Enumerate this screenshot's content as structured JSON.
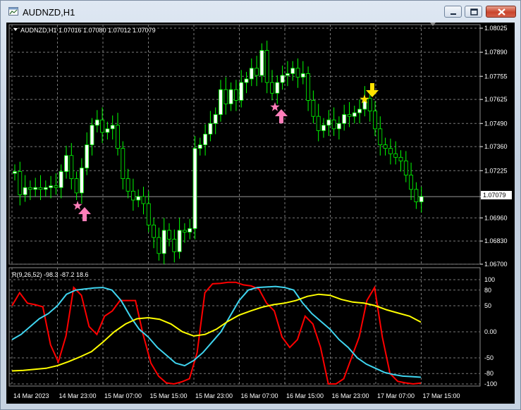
{
  "window": {
    "title": "AUDNZD,H1"
  },
  "chart": {
    "symbol_info": "AUDNZD,H1  1.07016 1.07080 1.07012 1.07079",
    "current_price": "1.07079",
    "price_ticks": [
      "1.08025",
      "1.07890",
      "1.07755",
      "1.07625",
      "1.07490",
      "1.07360",
      "1.07225",
      "1.07079",
      "1.06960",
      "1.06830",
      "1.06700"
    ],
    "indicator_label": "R(9,26,52) -98.3 -87.2 18.6",
    "indicator_ticks": [
      "100",
      "80",
      "50",
      "0.00",
      "-50",
      "-80",
      "-100"
    ],
    "time_ticks": [
      "14 Mar 2023",
      "14 Mar 23:00",
      "15 Mar 07:00",
      "15 Mar 15:00",
      "15 Mar 23:00",
      "16 Mar 07:00",
      "16 Mar 15:00",
      "16 Mar 23:00",
      "17 Mar 07:00",
      "17 Mar 15:00"
    ],
    "colors": {
      "background": "#000000",
      "bull": "#ffffff",
      "bear": "#000000",
      "wick": "#00ff00",
      "fast": "#ff0000",
      "mid": "#3fd5f0",
      "slow": "#ffff00",
      "buy_signal": "#ff7eb9",
      "sell_signal": "#ffe100"
    }
  },
  "chart_data": [
    {
      "type": "candlestick",
      "title": "AUDNZD,H1",
      "ylim": [
        1.067,
        1.08025
      ],
      "series_note": "approximate open/close per hourly bar",
      "candles": [
        [
          1.0721,
          1.0722
        ],
        [
          1.0722,
          1.0709
        ],
        [
          1.0709,
          1.0713
        ],
        [
          1.0713,
          1.0712
        ],
        [
          1.0712,
          1.0713
        ],
        [
          1.0713,
          1.0712
        ],
        [
          1.0712,
          1.0713
        ],
        [
          1.0713,
          1.0714
        ],
        [
          1.0714,
          1.0713
        ],
        [
          1.0713,
          1.0722
        ],
        [
          1.0722,
          1.0731
        ],
        [
          1.0731,
          1.0718
        ],
        [
          1.0718,
          1.071
        ],
        [
          1.071,
          1.0724
        ],
        [
          1.0724,
          1.0737
        ],
        [
          1.0737,
          1.0748
        ],
        [
          1.0748,
          1.0751
        ],
        [
          1.0751,
          1.0744
        ],
        [
          1.0744,
          1.0746
        ],
        [
          1.0746,
          1.0748
        ],
        [
          1.0748,
          1.0735
        ],
        [
          1.0735,
          1.0718
        ],
        [
          1.0718,
          1.0711
        ],
        [
          1.0711,
          1.0706
        ],
        [
          1.0706,
          1.0708
        ],
        [
          1.0708,
          1.0704
        ],
        [
          1.0704,
          1.0692
        ],
        [
          1.0692,
          1.0685
        ],
        [
          1.0685,
          1.0676
        ],
        [
          1.0676,
          1.0689
        ],
        [
          1.0689,
          1.0684
        ],
        [
          1.0684,
          1.0677
        ],
        [
          1.0677,
          1.0689
        ],
        [
          1.0689,
          1.0688
        ],
        [
          1.0688,
          1.069
        ],
        [
          1.069,
          1.0735
        ],
        [
          1.0735,
          1.0737
        ],
        [
          1.0737,
          1.0743
        ],
        [
          1.0743,
          1.0749
        ],
        [
          1.0749,
          1.0754
        ],
        [
          1.0754,
          1.0768
        ],
        [
          1.0768,
          1.076
        ],
        [
          1.076,
          1.0768
        ],
        [
          1.0768,
          1.0762
        ],
        [
          1.0762,
          1.0772
        ],
        [
          1.0772,
          1.0774
        ],
        [
          1.0774,
          1.078
        ],
        [
          1.078,
          1.0776
        ],
        [
          1.0776,
          1.079
        ],
        [
          1.079,
          1.0772
        ],
        [
          1.0772,
          1.0766
        ],
        [
          1.0766,
          1.0772
        ],
        [
          1.0772,
          1.0776
        ],
        [
          1.0776,
          1.0777
        ],
        [
          1.0777,
          1.078
        ],
        [
          1.078,
          1.0775
        ],
        [
          1.0775,
          1.0777
        ],
        [
          1.0777,
          1.0762
        ],
        [
          1.0762,
          1.0753
        ],
        [
          1.0753,
          1.0745
        ],
        [
          1.0745,
          1.0748
        ],
        [
          1.0748,
          1.0751
        ],
        [
          1.0751,
          1.0746
        ],
        [
          1.0746,
          1.0749
        ],
        [
          1.0749,
          1.0754
        ],
        [
          1.0754,
          1.0753
        ],
        [
          1.0753,
          1.0755
        ],
        [
          1.0755,
          1.0757
        ],
        [
          1.0757,
          1.0763
        ],
        [
          1.0763,
          1.0756
        ],
        [
          1.0756,
          1.0746
        ],
        [
          1.0746,
          1.0737
        ],
        [
          1.0737,
          1.0735
        ],
        [
          1.0735,
          1.0732
        ],
        [
          1.0732,
          1.073
        ],
        [
          1.073,
          1.0728
        ],
        [
          1.0728,
          1.072
        ],
        [
          1.072,
          1.0712
        ],
        [
          1.0712,
          1.0705
        ],
        [
          1.0705,
          1.0708
        ]
      ]
    },
    {
      "type": "line",
      "title": "R(9,26,52)",
      "ylim": [
        -100,
        100
      ],
      "series": [
        {
          "name": "R 9",
          "values": [
            50,
            75,
            55,
            52,
            48,
            -25,
            -58,
            -8,
            85,
            70,
            10,
            -5,
            30,
            40,
            60,
            60,
            60,
            -5,
            -60,
            -85,
            -98,
            -100,
            -96,
            -90,
            -40,
            75,
            92,
            93,
            95,
            95,
            90,
            88,
            82,
            55,
            40,
            -10,
            -30,
            -15,
            30,
            15,
            -30,
            -100,
            -100,
            -90,
            -50,
            -10,
            60,
            85,
            -10,
            -80,
            -95,
            -98,
            -100,
            -98.3
          ]
        },
        {
          "name": "R 26",
          "values": [
            -15,
            -5,
            10,
            25,
            35,
            50,
            72,
            80,
            82,
            84,
            85,
            80,
            60,
            30,
            5,
            -10,
            -30,
            -45,
            -60,
            -65,
            -55,
            -40,
            -20,
            0,
            30,
            60,
            80,
            85,
            86,
            87,
            85,
            80,
            55,
            35,
            20,
            5,
            -15,
            -30,
            -50,
            -62,
            -70,
            -78,
            -82,
            -85,
            -86,
            -87.2
          ]
        },
        {
          "name": "R 52",
          "values": [
            -75,
            -74,
            -72,
            -70,
            -65,
            -57,
            -48,
            -38,
            -20,
            0,
            15,
            25,
            27,
            24,
            15,
            0,
            -8,
            -5,
            5,
            20,
            32,
            40,
            47,
            52,
            55,
            60,
            68,
            72,
            70,
            62,
            57,
            55,
            50,
            42,
            36,
            30,
            18.6
          ]
        }
      ]
    }
  ]
}
